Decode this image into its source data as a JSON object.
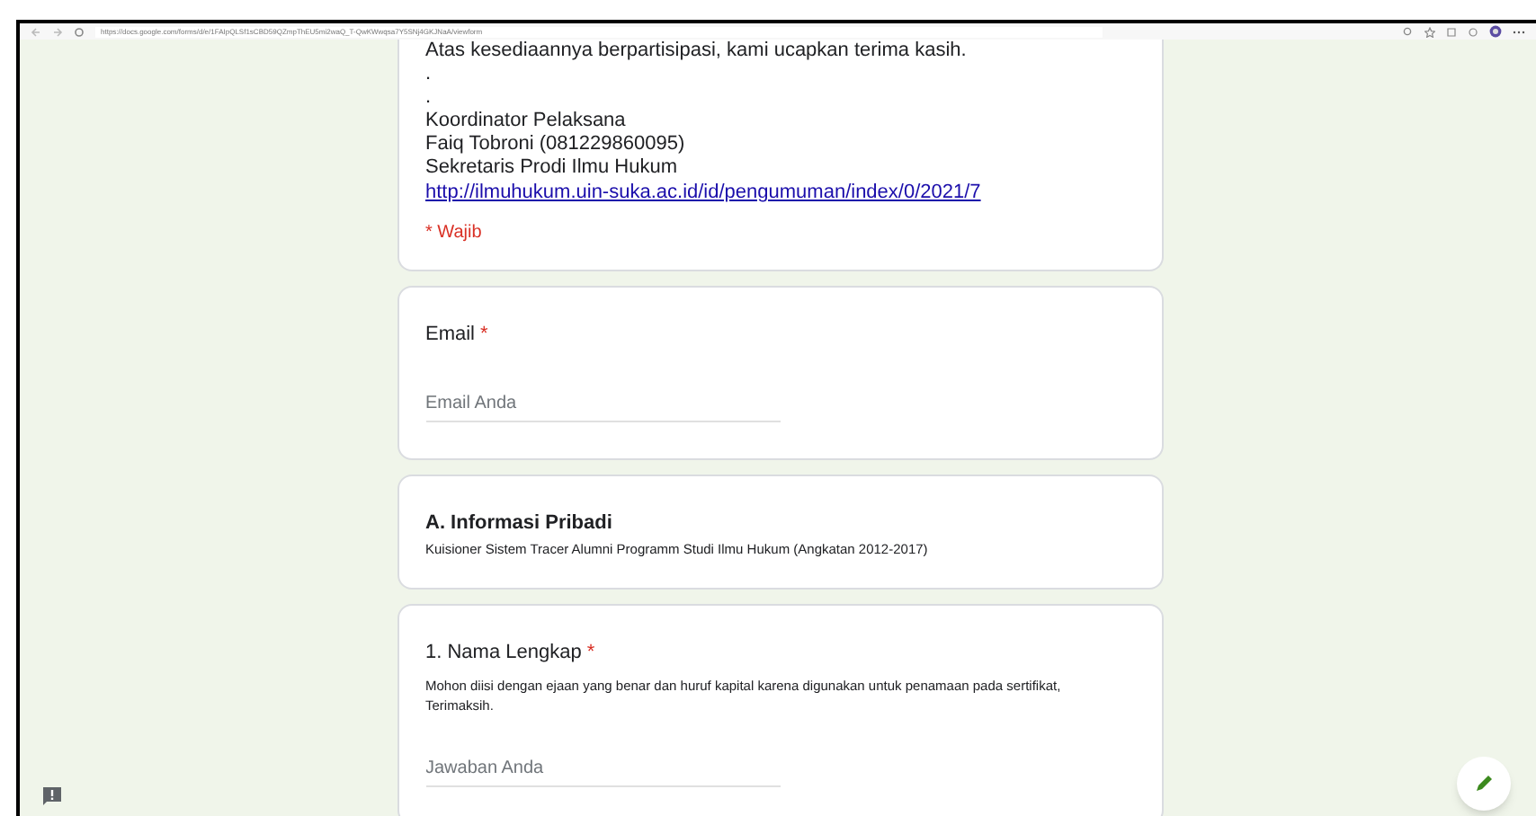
{
  "browser": {
    "url": "https://docs.google.com/forms/d/e/1FAIpQLSf1sCBD59QZmpThEU5mi2waQ_T-QwKWwqsa7Y5SNj4GKJNaA/viewform"
  },
  "intro": {
    "lines": [
      "Atas kesediaannya berpartisipasi, kami ucapkan terima kasih.",
      ".",
      ".",
      "Koordinator Pelaksana",
      "Faiq Tobroni (081229860095)",
      "Sekretaris Prodi Ilmu Hukum"
    ],
    "link": "http://ilmuhukum.uin-suka.ac.id/id/pengumuman/index/0/2021/7",
    "required_note": "* Wajib"
  },
  "cards": [
    {
      "kind": "question",
      "title": "Email",
      "required_mark": "*",
      "placeholder": "Email Anda"
    },
    {
      "kind": "section",
      "title": "A. Informasi Pribadi",
      "description": "Kuisioner Sistem Tracer Alumni Programm Studi Ilmu Hukum (Angkatan 2012-2017)"
    },
    {
      "kind": "question",
      "title": "1. Nama Lengkap",
      "required_mark": "*",
      "description": "Mohon diisi dengan ejaan yang benar dan huruf kapital karena digunakan untuk penamaan pada sertifikat, Terimaksih.",
      "placeholder": "Jawaban Anda"
    }
  ]
}
